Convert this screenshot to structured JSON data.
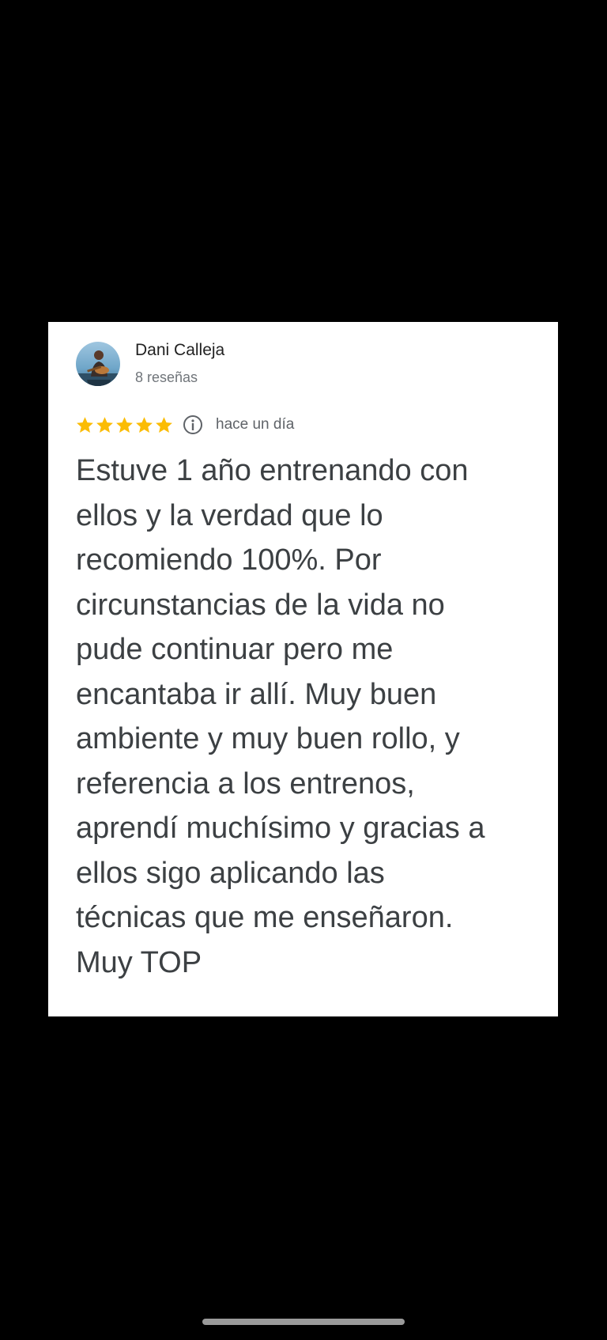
{
  "review": {
    "reviewer_name": "Dani Calleja",
    "review_count": "8 reseñas",
    "rating": 5,
    "rating_max": 5,
    "date": "hace un día",
    "lines": [
      "Estuve 1 año entrenando con",
      "ellos y la verdad que lo",
      "recomiendo 100%. Por",
      "circunstancias de la vida no",
      "pude continuar pero me",
      "encantaba ir allí. Muy buen",
      "ambiente y muy buen rollo, y",
      "referencia a los entrenos,",
      "aprendí muchísimo y gracias a",
      "ellos sigo aplicando las",
      "técnicas que me enseñaron.",
      "Muy TOP"
    ]
  },
  "icons": {
    "star": "star-icon",
    "info": "info-icon",
    "avatar": "avatar"
  },
  "colors": {
    "background": "#000000",
    "card": "#ffffff",
    "star": "#fbbc04",
    "text": "#3c4043",
    "secondary_text": "#70757a"
  }
}
